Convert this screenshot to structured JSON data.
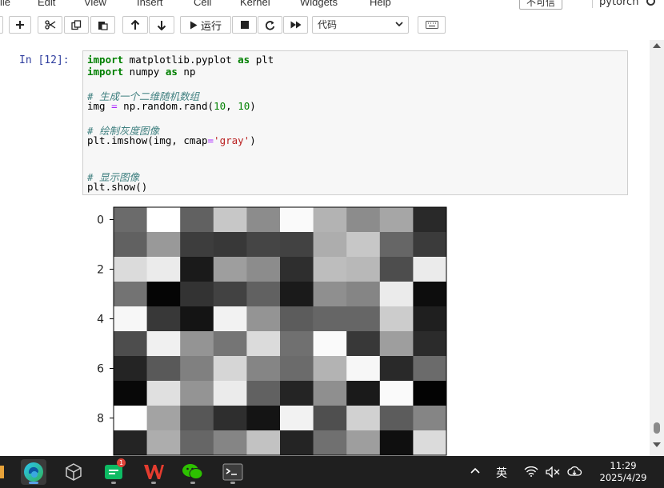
{
  "menubar": {
    "items": [
      "ile",
      "Edit",
      "View",
      "Insert",
      "Cell",
      "Kernel",
      "Widgets",
      "Help"
    ],
    "trusted_label": "不可信",
    "kernel_name": "pytorch"
  },
  "toolbar": {
    "run_label": "运行",
    "cell_type": "代码"
  },
  "cell": {
    "prompt": "In  [12]:",
    "lines": [
      "import matplotlib.pyplot as plt",
      "import numpy as np",
      "",
      "# 生成一个二维随机数组",
      "img = np.random.rand(10, 10)",
      "",
      "# 绘制灰度图像",
      "plt.imshow(img, cmap='gray')",
      "",
      "",
      "# 显示图像",
      "plt.show()"
    ]
  },
  "chart_data": {
    "type": "heatmap",
    "title": "",
    "xlabel": "",
    "ylabel": "",
    "colormap": "gray",
    "y_tick_labels": [
      "0",
      "2",
      "4",
      "6",
      "8"
    ],
    "y_ticks": [
      0,
      2,
      4,
      6,
      8
    ],
    "grey_levels": [
      [
        0.42,
        1.0,
        0.38,
        0.78,
        0.55,
        0.98,
        0.7,
        0.55,
        0.65,
        0.16
      ],
      [
        0.38,
        0.6,
        0.24,
        0.22,
        0.27,
        0.26,
        0.68,
        0.78,
        0.4,
        0.23
      ],
      [
        0.86,
        0.92,
        0.1,
        0.62,
        0.55,
        0.18,
        0.74,
        0.72,
        0.3,
        0.92
      ],
      [
        0.45,
        0.02,
        0.2,
        0.26,
        0.38,
        0.1,
        0.56,
        0.52,
        0.92,
        0.05
      ],
      [
        0.97,
        0.22,
        0.08,
        0.95,
        0.58,
        0.36,
        0.4,
        0.4,
        0.8,
        0.12
      ],
      [
        0.3,
        0.94,
        0.58,
        0.46,
        0.86,
        0.44,
        0.98,
        0.22,
        0.62,
        0.17
      ],
      [
        0.14,
        0.35,
        0.5,
        0.84,
        0.52,
        0.42,
        0.7,
        0.97,
        0.16,
        0.42
      ],
      [
        0.03,
        0.88,
        0.58,
        0.92,
        0.38,
        0.14,
        0.56,
        0.1,
        0.98,
        0.01
      ],
      [
        1.0,
        0.64,
        0.34,
        0.18,
        0.08,
        0.95,
        0.31,
        0.82,
        0.36,
        0.52
      ],
      [
        0.14,
        0.68,
        0.4,
        0.52,
        0.76,
        0.14,
        0.44,
        0.62,
        0.06,
        0.86
      ]
    ]
  },
  "taskbar": {
    "apps": [
      "edge-browser",
      "box-app",
      "green-app",
      "wps-app",
      "wechat-app",
      "terminal-app"
    ],
    "notification_count": "1",
    "ime_label": "英",
    "time": "11:29",
    "date": "2025/4/29"
  },
  "colors": {
    "prompt_blue": "#303f9f",
    "keyword_green": "#008000",
    "comment_teal": "#408080",
    "string_red": "#ba2121"
  }
}
